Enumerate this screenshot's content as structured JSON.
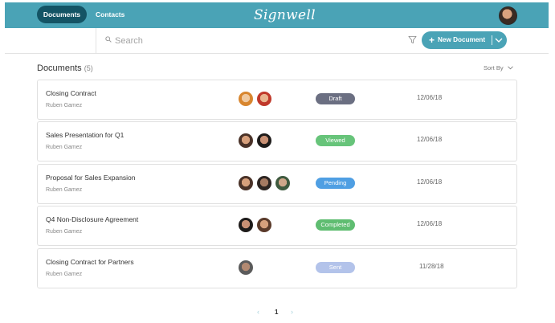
{
  "nav": {
    "documents_label": "Documents",
    "contacts_label": "Contacts",
    "logo_text": "Signwell"
  },
  "search": {
    "placeholder": "Search"
  },
  "toolbar": {
    "new_document_plus": "+",
    "new_document_label": "New Document"
  },
  "list": {
    "title": "Documents",
    "count": "(5)",
    "sort_label": "Sort By"
  },
  "documents": [
    {
      "title": "Closing Contract",
      "owner": "Ruben Gamez",
      "status": "Draft",
      "date": "12/06/18"
    },
    {
      "title": "Sales Presentation for Q1",
      "owner": "Ruben Gamez",
      "status": "Viewed",
      "date": "12/06/18"
    },
    {
      "title": "Proposal for Sales Expansion",
      "owner": "Ruben Gamez",
      "status": "Pending",
      "date": "12/06/18"
    },
    {
      "title": "Q4 Non-Disclosure Agreement",
      "owner": "Ruben Gamez",
      "status": "Completed",
      "date": "12/06/18"
    },
    {
      "title": "Closing Contract for Partners",
      "owner": "Ruben Gamez",
      "status": "Sent",
      "date": "11/28/18"
    }
  ],
  "status_colors": {
    "Draft": "#6b6f82",
    "Viewed": "#67c47a",
    "Pending": "#4f9fe3",
    "Completed": "#5fbd71",
    "Sent": "#b3c3ea"
  },
  "pagination": {
    "prev": "‹",
    "current": "1",
    "next": "›"
  },
  "colors": {
    "brand": "#4aa3b6",
    "nav_active": "#145465"
  }
}
